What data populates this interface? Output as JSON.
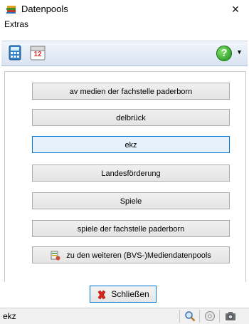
{
  "window": {
    "title": "Datenpools",
    "close_glyph": "×",
    "icon": "books-icon"
  },
  "menu": {
    "items": [
      "Extras"
    ]
  },
  "toolbar": {
    "buttons": [
      "calculator-icon",
      "calendar-icon"
    ],
    "calendar_number": "12",
    "help_glyph": "?",
    "dropdown_glyph": "▼"
  },
  "pools": [
    {
      "label": "av medien der fachstelle paderborn"
    },
    {
      "label": "delbrück"
    },
    {
      "label": "ekz"
    },
    {
      "label": "Landesförderung"
    },
    {
      "label": "Spiele"
    },
    {
      "label": "spiele der fachstelle paderborn"
    },
    {
      "label": "zu den weiteren (BVS-)Mediendatenpools"
    }
  ],
  "close_button": {
    "label": "Schließen"
  },
  "status": {
    "text": "ekz",
    "icons": [
      "magnifier-icon",
      "cd-icon",
      "camera-icon"
    ]
  },
  "colors": {
    "focus_border": "#0078d7",
    "toolbar_gradient_top": "#f1f5fb",
    "toolbar_gradient_bottom": "#d9e3f1"
  }
}
